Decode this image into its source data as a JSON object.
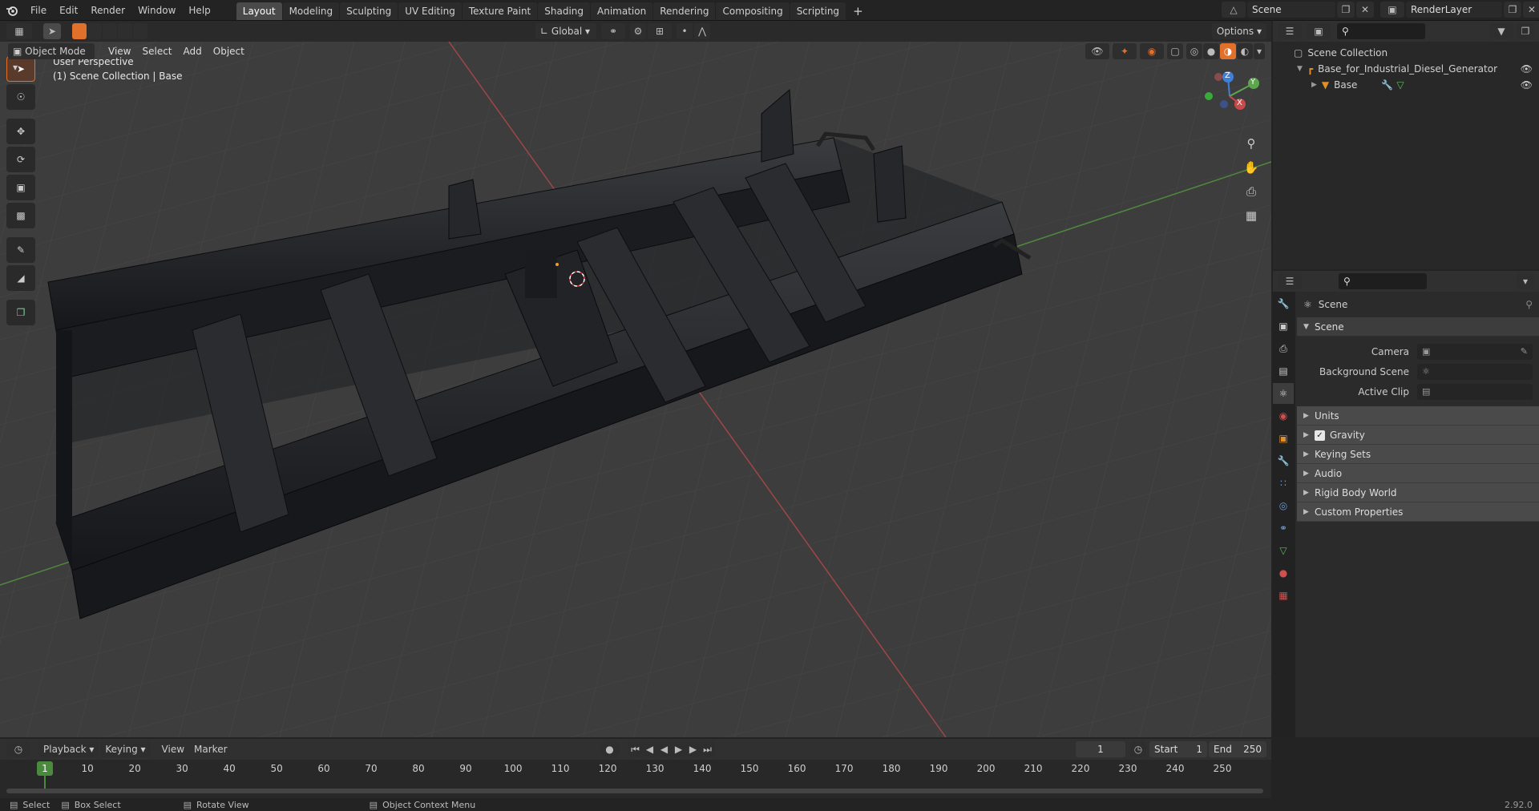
{
  "menu": {
    "items": [
      "File",
      "Edit",
      "Render",
      "Window",
      "Help"
    ]
  },
  "workspaces": {
    "tabs": [
      "Layout",
      "Modeling",
      "Sculpting",
      "UV Editing",
      "Texture Paint",
      "Shading",
      "Animation",
      "Rendering",
      "Compositing",
      "Scripting"
    ],
    "active": "Layout",
    "add": "+"
  },
  "topright": {
    "scene_label": "Scene",
    "renderlayer_label": "RenderLayer"
  },
  "viewport_header": {
    "mode": "Object Mode",
    "menus": [
      "View",
      "Select",
      "Add",
      "Object"
    ],
    "orientation": "Global",
    "options_label": "Options"
  },
  "viewport_overlay": {
    "perspective": "User Perspective",
    "collection": "(1) Scene Collection | Base"
  },
  "gizmo": {
    "z": "Z",
    "y": "Y",
    "x": "X"
  },
  "outliner": {
    "root": "Scene Collection",
    "collection": "Base_for_Industrial_Diesel_Generator",
    "object": "Base"
  },
  "properties": {
    "context": "Scene",
    "panel_title": "Scene",
    "rows": [
      {
        "label": "Camera"
      },
      {
        "label": "Background Scene"
      },
      {
        "label": "Active Clip"
      }
    ],
    "subpanels": [
      "Units",
      "Gravity",
      "Keying Sets",
      "Audio",
      "Rigid Body World",
      "Custom Properties"
    ],
    "gravity_checked": true
  },
  "timeline": {
    "menus": [
      "Playback",
      "Keying",
      "View",
      "Marker"
    ],
    "current_frame": "1",
    "start_label": "Start",
    "start": "1",
    "end_label": "End",
    "end": "250",
    "ticks": [
      "1",
      "10",
      "20",
      "30",
      "40",
      "50",
      "60",
      "70",
      "80",
      "90",
      "100",
      "110",
      "120",
      "130",
      "140",
      "150",
      "160",
      "170",
      "180",
      "190",
      "200",
      "210",
      "220",
      "230",
      "240",
      "250"
    ]
  },
  "statusbar": {
    "select": "Select",
    "box_select": "Box Select",
    "rotate": "Rotate View",
    "context_menu": "Object Context Menu",
    "version": "2.92.0"
  },
  "colors": {
    "accent": "#e0702a",
    "axis_x": "#c84a4a",
    "axis_y": "#5ca64c",
    "axis_z": "#3e7fd8",
    "bg_viewport": "#3d3d3d"
  }
}
